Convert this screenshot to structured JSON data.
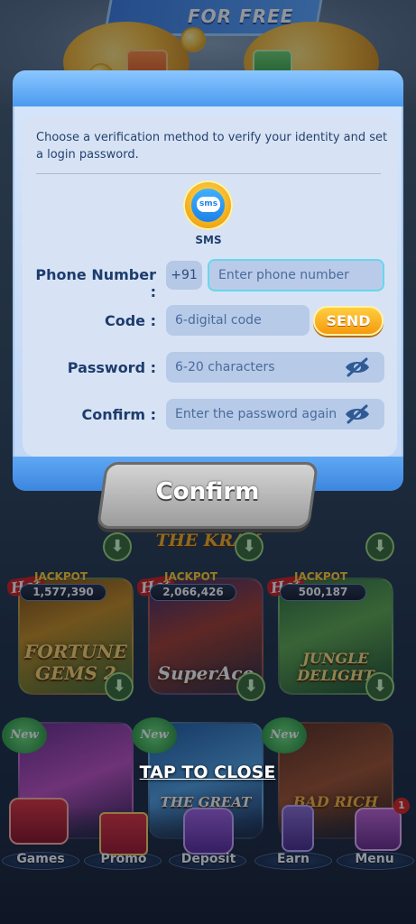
{
  "banner": {
    "text": "FOR FREE"
  },
  "dialog": {
    "instruction": "Choose a verification method to verify your identity and set a login password.",
    "method": {
      "label": "SMS",
      "icon_text": "sms"
    },
    "phone": {
      "label": "Phone Number :",
      "prefix": "+91",
      "placeholder": "Enter phone number"
    },
    "code": {
      "label": "Code :",
      "placeholder": "6-digital code",
      "send_label": "SEND"
    },
    "password": {
      "label": "Password :",
      "placeholder": "6-20 characters"
    },
    "confirm_field": {
      "label": "Confirm :",
      "placeholder": "Enter the password again"
    },
    "confirm_button": "Confirm"
  },
  "close_text": "TAP TO CLOSE",
  "lobby": {
    "top_game": "THE KRAK",
    "jackpot_label": "JACKPOT",
    "hot_label": "Hot",
    "new_label": "New",
    "jackpots": [
      {
        "value": "1,577,390",
        "title": "FORTUNE GEMS 2"
      },
      {
        "value": "2,066,426",
        "title": "SuperAce"
      },
      {
        "value": "500,187",
        "title": "JUNGLE DELIGHT"
      }
    ],
    "new_games": [
      {
        "title": ""
      },
      {
        "title": "THE GREAT"
      },
      {
        "title": "BAD RICH"
      }
    ]
  },
  "nav": [
    {
      "label": "Games"
    },
    {
      "label": "Promo"
    },
    {
      "label": "Deposit"
    },
    {
      "label": "Earn"
    },
    {
      "label": "Menu"
    }
  ],
  "colors": {
    "panel_bg": "#d7e3f4",
    "field_bg": "#b7cae7",
    "label_text": "#1d3c6d",
    "send_button": "#f59a10",
    "confirm_button": "#9c9c9c",
    "focus_border": "#66d7ef"
  }
}
